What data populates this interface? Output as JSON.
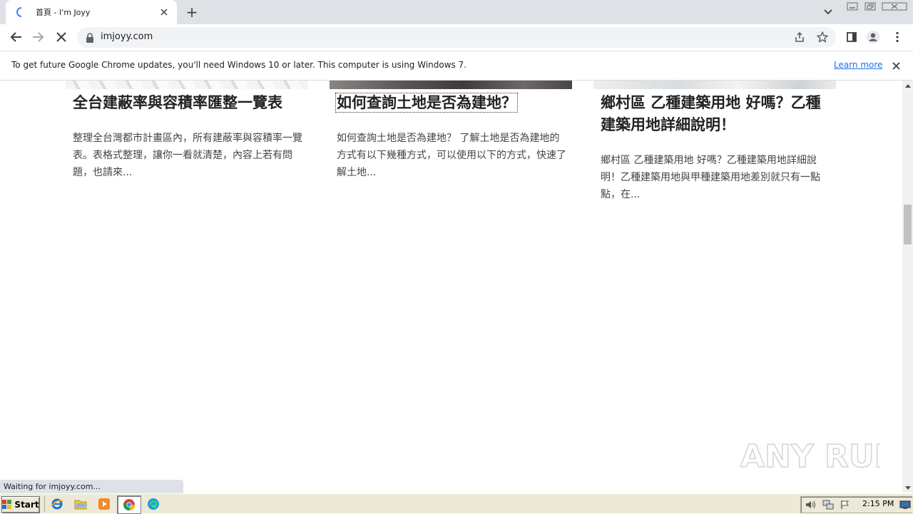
{
  "browser": {
    "tab_title": "首頁 - I'm Joyy",
    "url": "imjoyy.com",
    "new_tab_symbol": "+",
    "icons": {
      "back": "arrow-left-icon",
      "forward": "arrow-right-icon",
      "stop": "stop-loading-icon",
      "lock": "lock-icon",
      "share": "share-icon",
      "bookmark": "star-icon",
      "side_panel": "side-panel-icon",
      "profile": "profile-icon",
      "menu": "kebab-menu-icon"
    }
  },
  "infobar": {
    "message": "To get future Google Chrome updates, you'll need Windows 10 or later. This computer is using Windows 7.",
    "link": "Learn more"
  },
  "articles": [
    {
      "title": "全台建蔽率與容積率匯整一覽表",
      "excerpt": "整理全台灣都市計畫區內，所有建蔽率與容積率一覽表。表格式整理，讓你一看就清楚，內容上若有問題，也請來..."
    },
    {
      "title": "如何查詢土地是否為建地？",
      "excerpt": "如何查詢土地是否為建地？ 了解土地是否為建地的方式有以下幾種方式，可以使用以下的方式，快速了解土地..."
    },
    {
      "title": "鄉村區 乙種建築用地 好嗎？乙種建築用地詳細說明！",
      "excerpt": "鄉村區 乙種建築用地 好嗎？乙種建築用地詳細說明！乙種建築用地與甲種建築用地差別就只有一點點，在..."
    }
  ],
  "status_bar": {
    "text": "Waiting for imjoyy.com..."
  },
  "watermark": {
    "text": "ANY RUN"
  },
  "taskbar": {
    "start_label": "Start",
    "clock": "2:15 PM"
  },
  "colors": {
    "tabstrip": "#dee1e6",
    "link": "#1a73e8",
    "taskbar": "#ece9d8"
  }
}
